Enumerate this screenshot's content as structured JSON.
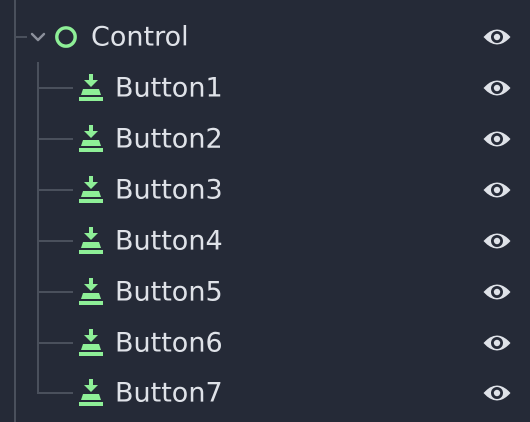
{
  "tree": {
    "root": {
      "label": "Control",
      "icon": "control-node-icon",
      "expanded": true,
      "visibility_icon": "eye-icon"
    },
    "children": [
      {
        "label": "Button1",
        "icon": "button-node-icon",
        "visibility_icon": "eye-icon"
      },
      {
        "label": "Button2",
        "icon": "button-node-icon",
        "visibility_icon": "eye-icon"
      },
      {
        "label": "Button3",
        "icon": "button-node-icon",
        "visibility_icon": "eye-icon"
      },
      {
        "label": "Button4",
        "icon": "button-node-icon",
        "visibility_icon": "eye-icon"
      },
      {
        "label": "Button5",
        "icon": "button-node-icon",
        "visibility_icon": "eye-icon"
      },
      {
        "label": "Button6",
        "icon": "button-node-icon",
        "visibility_icon": "eye-icon"
      },
      {
        "label": "Button7",
        "icon": "button-node-icon",
        "visibility_icon": "eye-icon"
      }
    ]
  },
  "colors": {
    "background": "#252a37",
    "text": "#dfe2e8",
    "node_icon": "#8eef97",
    "eye_icon": "#dfe2e8",
    "guide_line": "#4a505c"
  }
}
